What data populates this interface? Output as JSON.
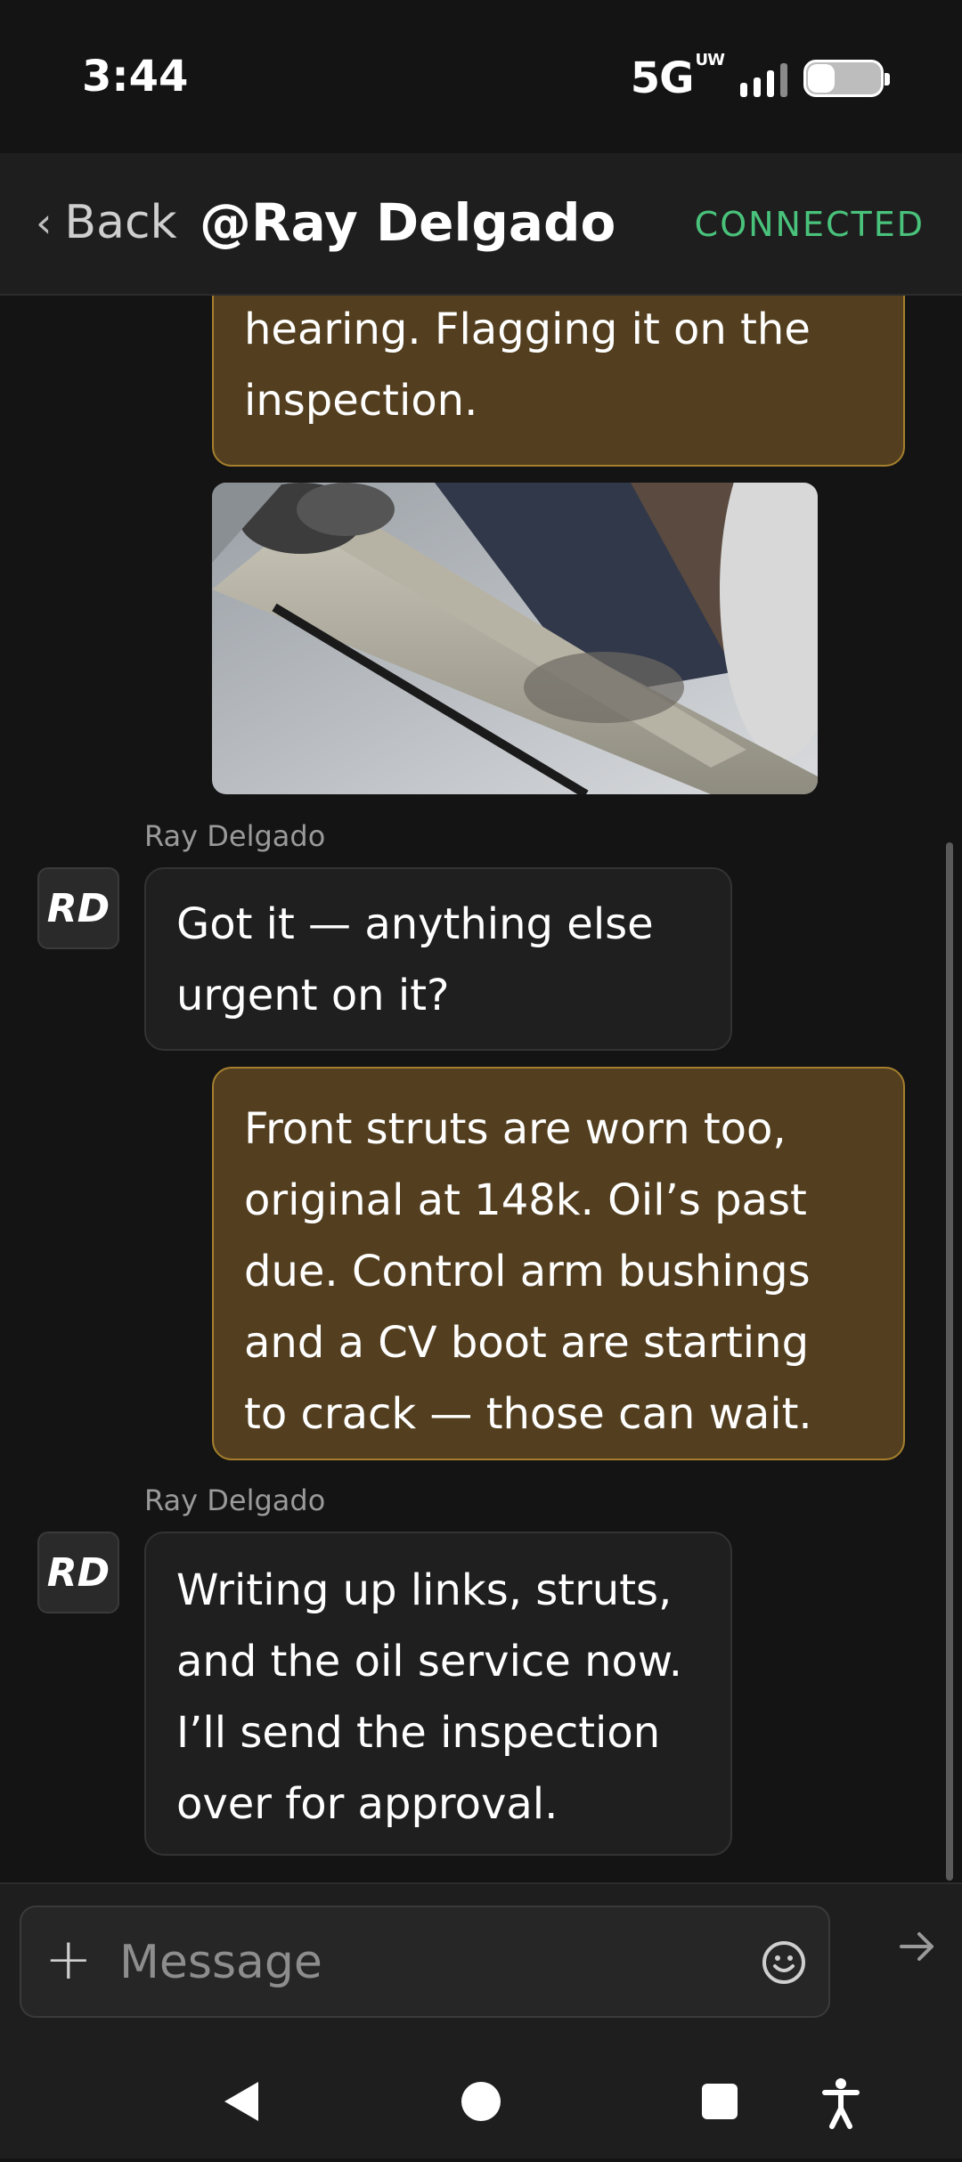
{
  "status": {
    "time": "3:44",
    "network": "5G",
    "network_sup": "UW"
  },
  "header": {
    "back_label": "Back",
    "title": "@Ray Delgado",
    "connection": "CONNECTED"
  },
  "messages": {
    "m1": {
      "line1": "hearing. Flagging it on the",
      "line2": "inspection."
    },
    "m2": {
      "sender": "Ray Delgado",
      "avatar": "RD",
      "line1": "Got it — anything else",
      "line2": "urgent on it?"
    },
    "m3": {
      "line1": "Front struts are worn too,",
      "line2": "original at 148k. Oil’s past",
      "line3": "due. Control arm bushings",
      "line4": "and a CV boot are starting",
      "line5": "to crack — those can wait."
    },
    "m4": {
      "sender": "Ray Delgado",
      "avatar": "RD",
      "line1": "Writing up links, struts,",
      "line2": "and the oil service now.",
      "line3": "I’ll send the inspection",
      "line4": "over for approval."
    }
  },
  "composer": {
    "placeholder": "Message"
  },
  "colors": {
    "accent_bubble": "#533f1f",
    "accent_border": "#a57f2d",
    "connected": "#49c27b"
  },
  "icons": [
    "chevron-left-icon",
    "plus-icon",
    "emoji-icon",
    "send-arrow-icon",
    "nav-back-icon",
    "nav-home-icon",
    "nav-recents-icon",
    "accessibility-icon"
  ]
}
